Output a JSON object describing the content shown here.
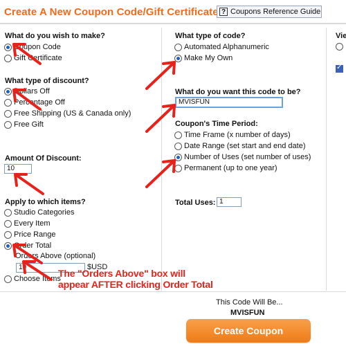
{
  "header": {
    "title": "Create A New Coupon Code/Gift Certificate",
    "help_button": "Coupons Reference Guide",
    "help_icon_glyph": "?"
  },
  "make": {
    "heading": "What do you wish to make?",
    "options": [
      {
        "label": "Coupon Code",
        "selected": true
      },
      {
        "label": "Gift Certificate",
        "selected": false
      }
    ]
  },
  "discount_type": {
    "heading": "What type of discount?",
    "options": [
      {
        "label": "Dollars Off",
        "selected": true
      },
      {
        "label": "Percentage Off",
        "selected": false
      },
      {
        "label": "Free Shipping (US & Canada only)",
        "selected": false
      },
      {
        "label": "Free Gift",
        "selected": false
      }
    ]
  },
  "amount": {
    "heading": "Amount Of Discount:",
    "value": "10"
  },
  "apply_to": {
    "heading": "Apply to which items?",
    "options": [
      {
        "label": "Studio Categories",
        "selected": false
      },
      {
        "label": "Every Item",
        "selected": false
      },
      {
        "label": "Price Range",
        "selected": false
      },
      {
        "label": "Order Total",
        "selected": true
      },
      {
        "label": "Choose Items",
        "selected": false
      }
    ],
    "orders_above_label": "Orders Above (optional)",
    "orders_above_value": "10",
    "currency": "$USD"
  },
  "code_type": {
    "heading": "What type of code?",
    "options": [
      {
        "label": "Automated Alphanumeric",
        "selected": false
      },
      {
        "label": "Make My Own",
        "selected": true
      }
    ]
  },
  "code_value": {
    "heading": "What do you want this code to be?",
    "value": "MVISFUN"
  },
  "time_period": {
    "heading": "Coupon's Time Period:",
    "options": [
      {
        "label": "Time Frame (x number of days)",
        "selected": false
      },
      {
        "label": "Date Range (set start and end date)",
        "selected": false
      },
      {
        "label": "Number of Uses (set number of uses)",
        "selected": true
      },
      {
        "label": "Permanent (up to one year)",
        "selected": false
      }
    ]
  },
  "total_uses": {
    "label": "Total Uses:",
    "value": "1"
  },
  "right_column": {
    "heading_partial": "Vie"
  },
  "annotation": {
    "line1": "The \"Orders Above\" box will",
    "line2": "appear AFTER clicking Order Total",
    "color": "#e8221a"
  },
  "footer": {
    "preview_label": "This Code Will Be...",
    "preview_code": "MVISFUN",
    "create_button": "Create Coupon"
  },
  "colors": {
    "title": "#f26a1b",
    "button_gradient_top": "#f9a04a",
    "button_gradient_bottom": "#ef7b16",
    "arrow": "#e8221a"
  }
}
